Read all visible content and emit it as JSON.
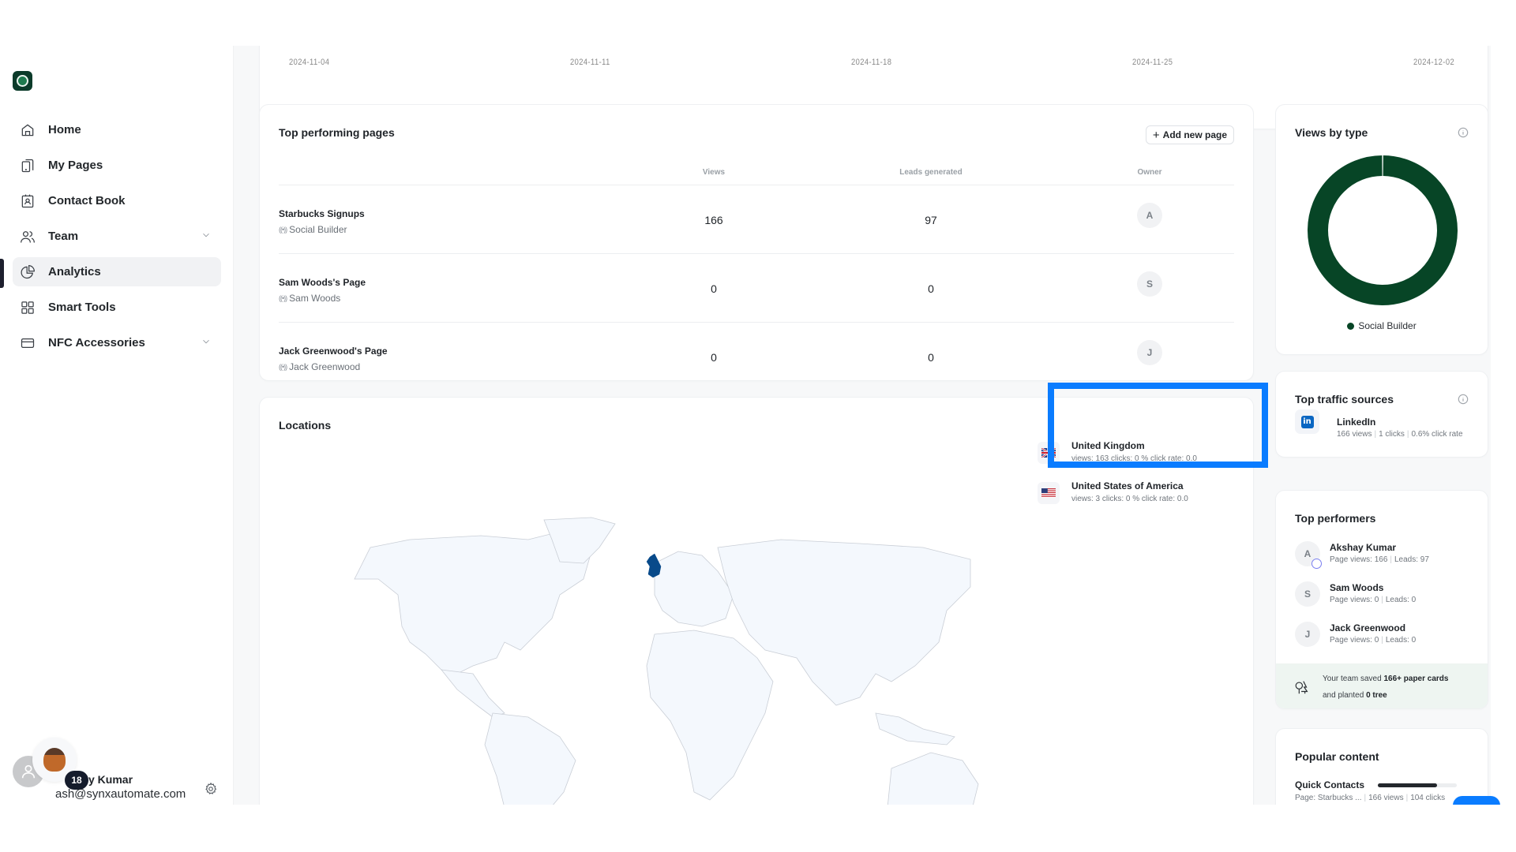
{
  "sidebar": {
    "logo_alt": "Starbucks",
    "items": [
      {
        "label": "Home",
        "icon": "home-icon"
      },
      {
        "label": "My Pages",
        "icon": "pages-icon"
      },
      {
        "label": "Contact Book",
        "icon": "contact-book-icon"
      },
      {
        "label": "Team",
        "icon": "team-icon",
        "expandable": true
      },
      {
        "label": "Analytics",
        "icon": "analytics-icon",
        "active": true
      },
      {
        "label": "Smart Tools",
        "icon": "grid-icon"
      },
      {
        "label": "NFC Accessories",
        "icon": "card-icon",
        "expandable": true
      }
    ],
    "user": {
      "name": "y Kumar",
      "email": "ash@synxautomate.com",
      "notification_count": "18"
    }
  },
  "chart_axis": {
    "ticks": [
      "2024-11-04",
      "2024-11-11",
      "2024-11-18",
      "2024-11-25",
      "2024-12-02"
    ]
  },
  "top_pages": {
    "title": "Top performing pages",
    "add_button": "Add new page",
    "columns": [
      "Views",
      "Leads generated",
      "Owner"
    ],
    "rows": [
      {
        "name": "Starbucks Signups",
        "sub": "Social Builder",
        "views": "166",
        "leads": "97",
        "owner": "A"
      },
      {
        "name": "Sam Woods's Page",
        "sub": "Sam Woods",
        "views": "0",
        "leads": "0",
        "owner": "S"
      },
      {
        "name": "Jack Greenwood's Page",
        "sub": "Jack Greenwood",
        "views": "0",
        "leads": "0",
        "owner": "J"
      }
    ]
  },
  "locations": {
    "title": "Locations",
    "highlight_color": "#084a8a",
    "items": [
      {
        "country": "United Kingdom",
        "flag": "uk",
        "stats": "views: 163 clicks: 0 % click rate: 0.0"
      },
      {
        "country": "United States of America",
        "flag": "us",
        "stats": "views: 3 clicks: 0 % click rate: 0.0"
      }
    ]
  },
  "views_by_type": {
    "title": "Views by type",
    "chart_data": {
      "type": "pie",
      "labels": [
        "Social Builder"
      ],
      "values": [
        100
      ],
      "colors": [
        "#074526"
      ],
      "legend": "bottom"
    }
  },
  "traffic": {
    "title": "Top traffic sources",
    "source": "LinkedIn",
    "views": "166 views",
    "clicks": "1 clicks",
    "rate": "0.6% click rate"
  },
  "performers": {
    "title": "Top performers",
    "items": [
      {
        "initial": "A",
        "name": "Akshay Kumar",
        "views": "Page views: 166",
        "leads": "Leads: 97",
        "crown": true
      },
      {
        "initial": "S",
        "name": "Sam Woods",
        "views": "Page views: 0",
        "leads": "Leads: 0"
      },
      {
        "initial": "J",
        "name": "Jack Greenwood",
        "views": "Page views: 0",
        "leads": "Leads: 0"
      }
    ],
    "eco": {
      "line1_pre": "Your team saved ",
      "line1_bold": "166+ paper cards",
      "line2_pre": "and planted ",
      "line2_bold": "0 tree"
    }
  },
  "popular": {
    "title": "Popular content",
    "item": "Quick Contacts",
    "progress": 0.75,
    "page": "Page: Starbucks ...",
    "views": "166 views",
    "clicks": "104 clicks"
  },
  "colors": {
    "accent_blue": "#0a7cff",
    "donut_green": "#074526",
    "linkedin": "#0a66c2"
  }
}
